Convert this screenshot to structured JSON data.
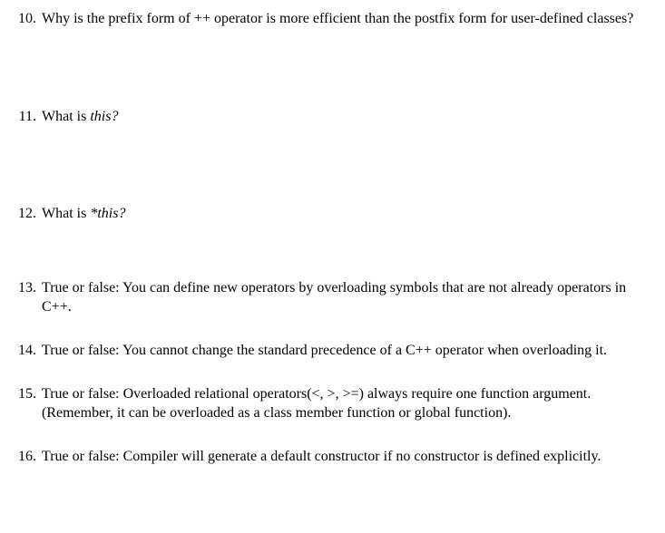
{
  "questions": [
    {
      "number": "10.",
      "text": "Why is the prefix form of ++ operator is more efficient than the postfix form for user-defined classes?",
      "gap": "gap-large"
    },
    {
      "number": "11.",
      "prefix": "What is ",
      "italic": "this?",
      "gap": "gap-large"
    },
    {
      "number": "12.",
      "prefix": "What is ",
      "italic": "*this?",
      "gap": "gap-medium"
    },
    {
      "number": "13.",
      "text": "True or false:  You can define new operators by overloading symbols that are not already operators in C++.",
      "gap": "gap-small"
    },
    {
      "number": "14.",
      "text": "True or false:  You cannot change the standard precedence of a C++ operator when overloading it.",
      "gap": "gap-small"
    },
    {
      "number": "15.",
      "text": "True or false:  Overloaded relational operators(<, >, >=)  always require one function argument. (Remember, it can be overloaded as a class member function or global function).",
      "gap": "gap-small"
    },
    {
      "number": "16.",
      "text": "True or false:  Compiler will generate a default constructor if no constructor is defined explicitly.",
      "gap": "gap-last"
    }
  ]
}
